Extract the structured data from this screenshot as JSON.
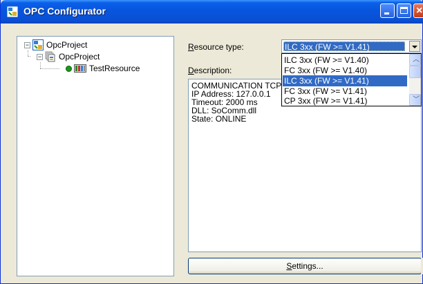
{
  "window": {
    "title": "OPC Configurator",
    "buttons": {
      "minimize": "minimize",
      "maximize": "maximize",
      "close": "×"
    }
  },
  "tree": {
    "items": [
      {
        "label": "OpcProject",
        "icon": "project-icon",
        "expander": "−"
      },
      {
        "label": "OpcProject",
        "icon": "folder-stack-icon",
        "expander": "−"
      },
      {
        "label": "TestResource",
        "icon": "resource-icon",
        "status_color": "#1a9a1a"
      }
    ]
  },
  "form": {
    "resource_type_label": "Resource type:",
    "resource_type_label_accel": "R",
    "resource_type_label_rest": "esource type:",
    "resource_type_value": "ILC 3xx (FW >= V1.41)",
    "description_label_accel": "D",
    "description_label_rest": "escription:",
    "resource_type_options": [
      "ILC 3xx (FW >= V1.40)",
      "FC 3xx (FW >= V1.40)",
      "ILC 3xx (FW >= V1.41)",
      "FC 3xx (FW >= V1.41)",
      "CP 3xx (FW >= V1.41)"
    ],
    "selected_option_index": 2,
    "description_lines": [
      "COMMUNICATION TCP/IP",
      "IP Address: 127.0.0.1",
      "Timeout: 2000 ms",
      "DLL: SoComm.dll",
      "State: ONLINE"
    ],
    "settings_accel": "S",
    "settings_rest": "ettings..."
  },
  "colors": {
    "titlebar": "#0855dd",
    "selection": "#316ac5",
    "window_bg": "#ece9d8",
    "status_online": "#1a9a1a"
  }
}
